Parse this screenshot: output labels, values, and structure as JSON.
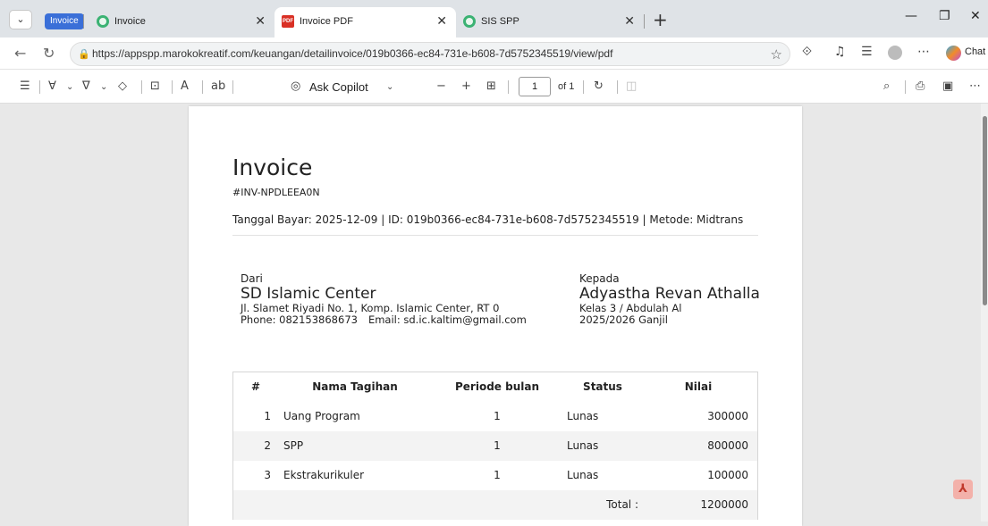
{
  "browser": {
    "tab_group_label": "Invoice",
    "tabs": [
      {
        "label": "Invoice"
      },
      {
        "label": "Invoice PDF"
      },
      {
        "label": "SIS SPP"
      }
    ],
    "url": "https://appspp.marokokreatif.com/keuangan/detailinvoice/019b0366-ec84-731e-b608-7d5752345519/view/pdf",
    "chat_label": "Chat"
  },
  "pdf_toolbar": {
    "ask_copilot": "Ask Copilot",
    "page_current": "1",
    "page_of": "of 1"
  },
  "invoice": {
    "title": "Invoice",
    "number": "#INV-NPDLEEA0N",
    "meta": "Tanggal Bayar: 2025-12-09 | ID: 019b0366-ec84-731e-b608-7d5752345519 | Metode: Midtrans",
    "from": {
      "label": "Dari",
      "name": "SD Islamic Center",
      "address": "Jl. Slamet Riyadi No. 1, Komp. Islamic Center, RT 0",
      "phone": "Phone: 082153868673",
      "email": "Email: sd.ic.kaltim@gmail.com"
    },
    "to": {
      "label": "Kepada",
      "name": "Adyastha Revan Athalla",
      "class": "Kelas 3 / Abdulah Al",
      "period": "2025/2026 Ganjil"
    },
    "table": {
      "headers": [
        "#",
        "Nama Tagihan",
        "Periode bulan",
        "Status",
        "Nilai"
      ],
      "rows": [
        {
          "no": "1",
          "name": "Uang Program",
          "periode": "1",
          "status": "Lunas",
          "nilai": "300000"
        },
        {
          "no": "2",
          "name": "SPP",
          "periode": "1",
          "status": "Lunas",
          "nilai": "800000"
        },
        {
          "no": "3",
          "name": "Ekstrakurikuler",
          "periode": "1",
          "status": "Lunas",
          "nilai": "100000"
        }
      ],
      "total_label": "Total :",
      "total_value": "1200000"
    }
  }
}
